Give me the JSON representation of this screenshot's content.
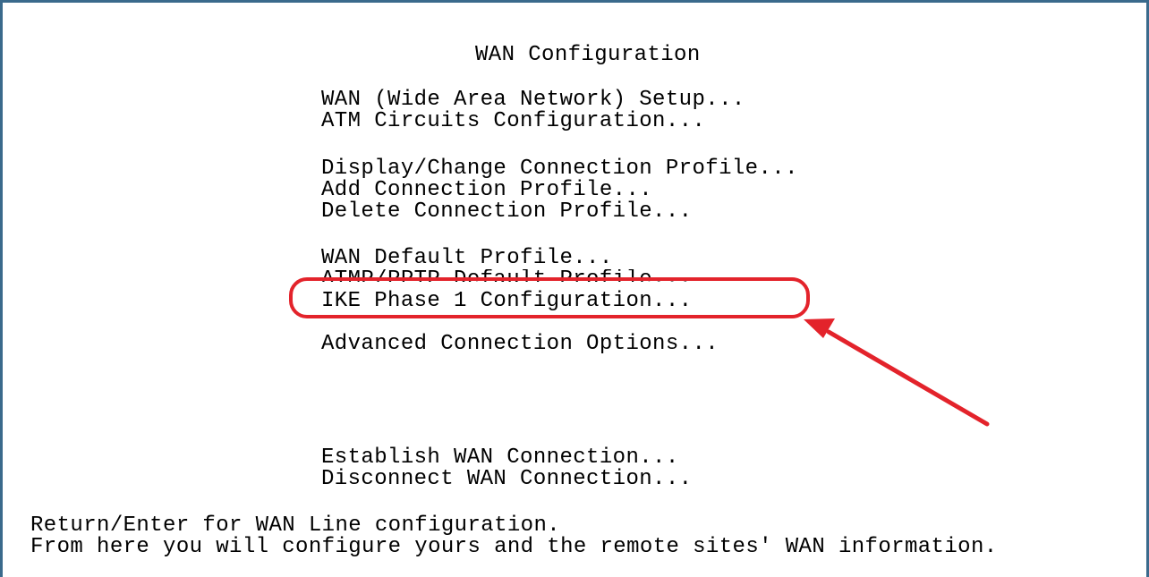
{
  "title": "WAN Configuration",
  "menu": [
    "WAN (Wide Area Network) Setup...",
    "ATM Circuits Configuration...",
    "Display/Change Connection Profile...",
    "Add Connection Profile...",
    "Delete Connection Profile...",
    "WAN Default Profile...",
    "ATMP/PPTP Default Profile...",
    "IKE Phase 1 Configuration...",
    "Advanced Connection Options...",
    "Establish WAN Connection...",
    "Disconnect WAN Connection..."
  ],
  "footer": [
    "Return/Enter for WAN Line configuration.",
    "From here you will configure yours and the remote sites' WAN information."
  ],
  "highlight": {
    "target": "IKE Phase 1 Configuration...",
    "color": "#e3232b"
  },
  "frame_color": "#3a6a8c"
}
